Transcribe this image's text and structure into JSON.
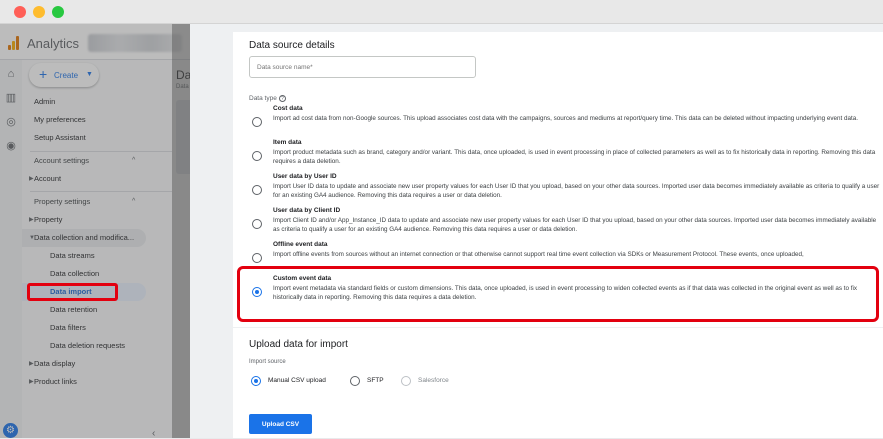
{
  "app": {
    "title": "Analytics"
  },
  "sidebar": {
    "create_label": "Create",
    "items": {
      "admin": "Admin",
      "my_preferences": "My preferences",
      "setup_assistant": "Setup Assistant",
      "account_settings": "Account settings",
      "account": "Account",
      "property_settings": "Property settings",
      "property": "Property",
      "data_collection": "Data collection and modifica...",
      "data_streams": "Data streams",
      "data_collection_sub": "Data collection",
      "data_import": "Data import",
      "data_retention": "Data retention",
      "data_filters": "Data filters",
      "data_deletion_requests": "Data deletion requests",
      "data_display": "Data display",
      "product_links": "Product links"
    }
  },
  "background_page": {
    "title": "Da",
    "subtitle": "Data"
  },
  "details": {
    "heading": "Data source details",
    "name_placeholder": "Data source name*",
    "data_type_label": "Data type",
    "options": [
      {
        "title": "Cost data",
        "desc": "Import ad cost data from non-Google sources. This upload associates cost data with the campaigns, sources and mediums at report/query time. This data can be deleted without impacting underlying event data.",
        "selected": false
      },
      {
        "title": "Item data",
        "desc": "Import product metadata such as brand, category and/or variant. This data, once uploaded, is used in event processing in place of collected parameters as well as to fix historically data in reporting. Removing this data requires a data deletion.",
        "selected": false
      },
      {
        "title": "User data by User ID",
        "desc": "Import User ID data to update and associate new user property values for each User ID that you upload, based on your other data sources. Imported user data becomes immediately available as criteria to qualify a user for an existing GA4 audience. Removing this data requires a user or data deletion.",
        "selected": false
      },
      {
        "title": "User data by Client ID",
        "desc": "Import Client ID and/or App_Instance_ID data to update and associate new user property values for each User ID that you upload, based on your other data sources. Imported user data becomes immediately available as criteria to qualify a user for an existing GA4 audience. Removing this data requires a user or data deletion.",
        "selected": false
      },
      {
        "title": "Offline event data",
        "desc": "Import offline events from sources without an internet connection or that otherwise cannot support real time event collection via SDKs or Measurement Protocol. These events, once uploaded,",
        "selected": false
      },
      {
        "title": "Custom event data",
        "desc": "Import event metadata via standard fields or custom dimensions. This data, once uploaded, is used in event processing to widen collected events as if that data was collected in the original event as well as to fix historically data in reporting. Removing this data requires a data deletion.",
        "selected": true
      }
    ]
  },
  "upload": {
    "heading": "Upload data for import",
    "source_label": "Import source",
    "sources": [
      "Manual CSV upload",
      "SFTP",
      "Salesforce"
    ],
    "selected_source": "Manual CSV upload",
    "button_label": "Upload CSV"
  },
  "colors": {
    "accent": "#1a73e8",
    "highlight": "#e3000f"
  }
}
